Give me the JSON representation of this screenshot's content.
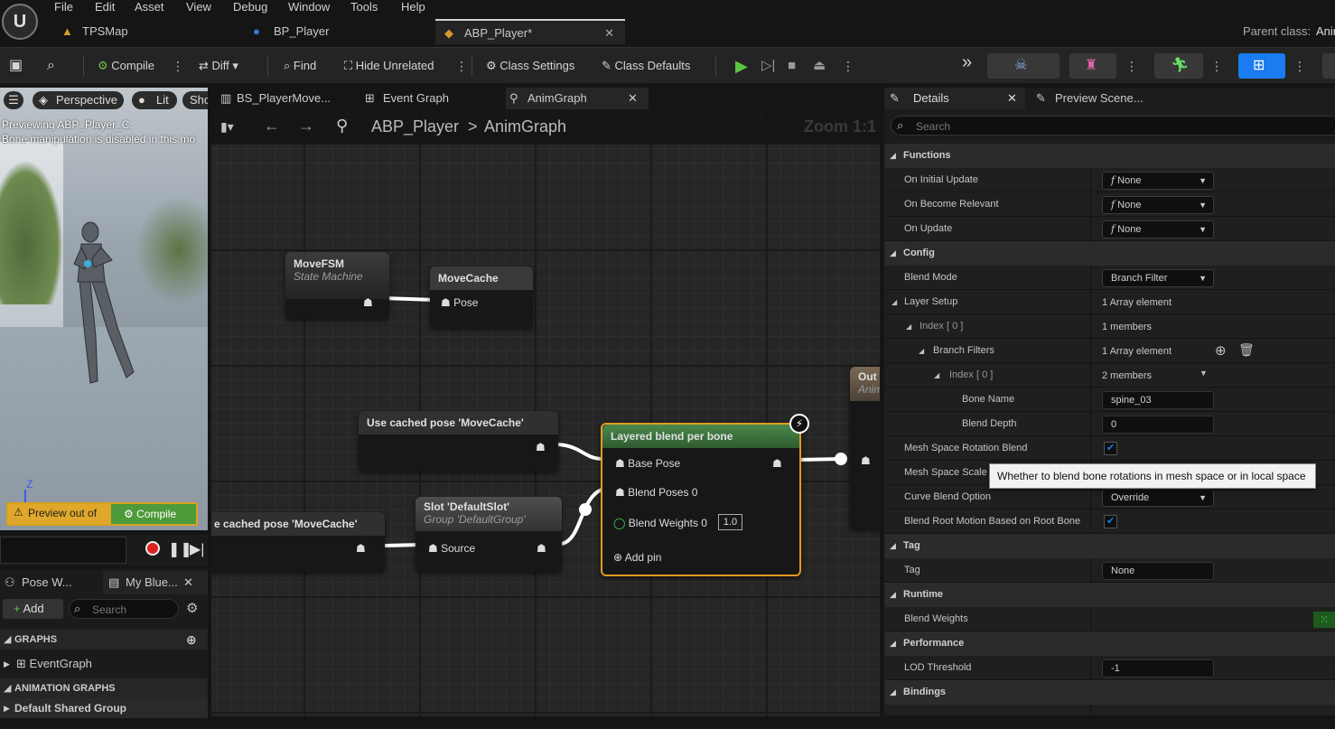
{
  "menu": [
    "File",
    "Edit",
    "Asset",
    "View",
    "Debug",
    "Window",
    "Tools",
    "Help"
  ],
  "doc_tabs": {
    "tps": "TPSMap",
    "bp": "BP_Player",
    "abp": "ABP_Player*"
  },
  "parent_class": {
    "label": "Parent class:",
    "value": "Anim"
  },
  "toolbar": {
    "compile": "Compile",
    "diff": "Diff",
    "find": "Find",
    "hide_unrelated": "Hide Unrelated",
    "class_settings": "Class Settings",
    "class_defaults": "Class Defaults"
  },
  "viewport": {
    "perspective": "Perspective",
    "lit": "Lit",
    "show": "Sho",
    "line1": "Previewing ABP_Player_C.",
    "line2": "Bone manipulation is disabled in this mo",
    "warn": "Preview out of",
    "compile": "Compile",
    "axis": "Z"
  },
  "left": {
    "tab_pose": "Pose W...",
    "tab_blue": "My Blue...",
    "add": "Add",
    "search_ph": "Search",
    "graphs": "GRAPHS",
    "event_graph": "EventGraph",
    "anim_graphs": "ANIMATION GRAPHS",
    "default_group": "Default Shared Group"
  },
  "graph_tabs": {
    "bs": "BS_PlayerMove...",
    "event": "Event Graph",
    "anim": "AnimGraph"
  },
  "breadcrumb": {
    "root": "ABP_Player",
    "sep": ">",
    "leaf": "AnimGraph",
    "zoom": "Zoom 1:1"
  },
  "nodes": {
    "movefsm": {
      "title": "MoveFSM",
      "subtitle": "State Machine"
    },
    "movecache": {
      "title": "MoveCache",
      "pin": "Pose"
    },
    "use_cached": {
      "title": "Use cached pose 'MoveCache'"
    },
    "use_cached2": {
      "title": "e cached pose 'MoveCache'"
    },
    "slot": {
      "title": "Slot 'DefaultSlot'",
      "subtitle": "Group 'DefaultGroup'",
      "pin": "Source"
    },
    "layered": {
      "title": "Layered blend per bone",
      "base": "Base Pose",
      "blend_poses": "Blend Poses 0",
      "blend_weights": "Blend Weights 0",
      "weight_value": "1.0",
      "add_pin": "Add pin"
    },
    "output": {
      "title": "Out",
      "subtitle": "Anim"
    }
  },
  "details": {
    "tab": "Details",
    "preview_tab": "Preview Scene...",
    "search_ph": "Search",
    "functions": "Functions",
    "on_initial": "On Initial Update",
    "on_become": "On Become Relevant",
    "on_update": "On Update",
    "none": "None",
    "config": "Config",
    "blend_mode": "Blend Mode",
    "blend_mode_val": "Branch Filter",
    "layer_setup": "Layer Setup",
    "array1": "1 Array element",
    "index0": "Index [ 0 ]",
    "members1": "1 members",
    "branch_filters": "Branch Filters",
    "members2": "2 members",
    "bone_name": "Bone Name",
    "bone_name_val": "spine_03",
    "blend_depth": "Blend Depth",
    "blend_depth_val": "0",
    "mesh_rot": "Mesh Space Rotation Blend",
    "mesh_scale": "Mesh Space Scale",
    "curve_blend": "Curve Blend Option",
    "curve_blend_val": "Override",
    "root_motion": "Blend Root Motion Based on Root Bone",
    "tag_cat": "Tag",
    "tag": "Tag",
    "tag_val": "None",
    "runtime": "Runtime",
    "blend_weights": "Blend Weights",
    "performance": "Performance",
    "lod": "LOD Threshold",
    "lod_val": "-1",
    "bindings": "Bindings"
  },
  "tooltip": "Whether to blend bone rotations in mesh space or in local space",
  "colors": {
    "accent_orange": "#e49b1f",
    "compile_green": "#4d9a3a",
    "layered_header": "#3f7a3f",
    "details_blue": "#1a7cf0"
  }
}
